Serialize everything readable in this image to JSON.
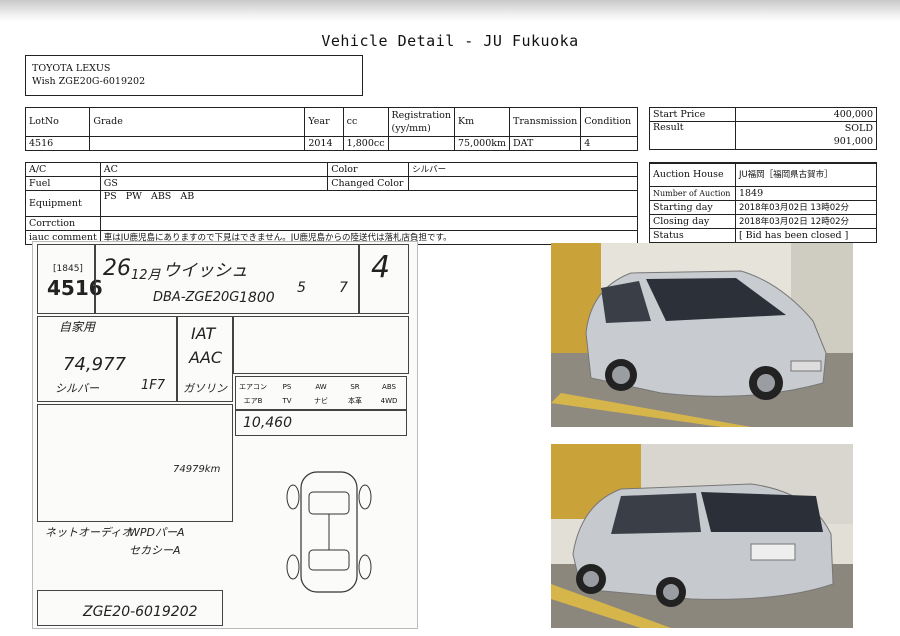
{
  "page": {
    "title": "Vehicle Detail - JU Fukuoka"
  },
  "vehicle": {
    "make": "TOYOTA LEXUS",
    "model_line": "Wish ZGE20G-6019202"
  },
  "main_table": {
    "headers": [
      "LotNo",
      "Grade",
      "Year",
      "cc",
      "Registration\n(yy/mm)",
      "Km",
      "Transmission",
      "Condition"
    ],
    "values": [
      "4516",
      "",
      "2014",
      "1,800cc",
      "",
      "75,000km",
      "DAT",
      "4"
    ]
  },
  "specs": {
    "ac_label": "A/C",
    "ac_value": "AC",
    "color_label": "Color",
    "color_value": "シルバー",
    "fuel_label": "Fuel",
    "fuel_value": "GS",
    "changed_color_label": "Changed Color",
    "changed_color_value": "",
    "equipment_label": "Equipment",
    "equipment_value": "PS   PW   ABS   AB",
    "correction_label": "Corrction",
    "correction_value": "",
    "comment_label": "iauc comment",
    "comment_value": "車はJU鹿児島にありますので下見はできません。JU鹿児島からの陸送代は落札店負担です。"
  },
  "price": {
    "start_label": "Start Price",
    "start_value": "400,000",
    "result_label": "Result",
    "result_status": "SOLD",
    "result_value": "901,000"
  },
  "auction": {
    "house_label": "Auction House",
    "house_value": "JU福岡［福岡県古賀市］",
    "number_label": "Number of Auction",
    "number_value": "1849",
    "starting_label": "Starting day",
    "starting_value": "2018年03月02日 13時02分",
    "closing_label": "Closing day",
    "closing_value": "2018年03月02日 12時02分",
    "status_label": "Status",
    "status_value": "[ Bid has been closed ]"
  },
  "sheet": {
    "lot_prefix": "[1845]",
    "lot_no": "4516",
    "year": "26",
    "month": "12月",
    "car_name": "ウイッシュ",
    "chassis": "DBA-ZGE20G",
    "cc": "1800",
    "doors": "5",
    "seats": "7",
    "score": "4",
    "color_text": "自家用",
    "mileage": "74,977",
    "color_jp": "シルバー",
    "color_code": "1F7",
    "trans": "IAT",
    "ac": "AAC",
    "fuel": "ガソリン",
    "price_note": "10,460",
    "km_note": "74979km",
    "comment1": "ネットオーディオ",
    "comment2": "WPDパーA",
    "comment3": "セカシーA",
    "reg_no": "ZGE20-6019202",
    "equip": [
      "エアコン",
      "PS",
      "AW",
      "SR",
      "ABS",
      "エアB",
      "TV",
      "ナビ",
      "本革",
      "4WD"
    ]
  },
  "colors": {
    "photo_bg": "#d9d4c4",
    "car": "#c4c8cc"
  }
}
